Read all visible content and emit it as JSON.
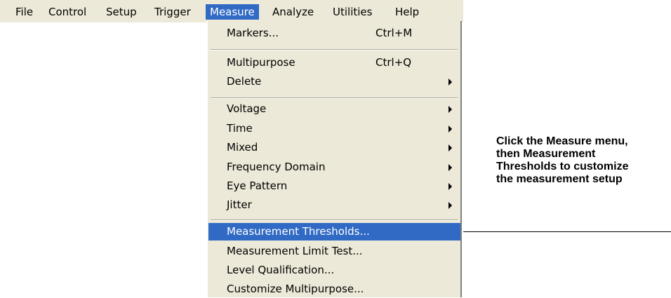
{
  "menubar": {
    "items": [
      {
        "label": "File"
      },
      {
        "label": "Control"
      },
      {
        "label": "Setup"
      },
      {
        "label": "Trigger"
      },
      {
        "label": "Measure",
        "active": true
      },
      {
        "label": "Analyze"
      },
      {
        "label": "Utilities"
      },
      {
        "label": "Help"
      }
    ]
  },
  "measure_menu": {
    "items": [
      {
        "label": "Markers...",
        "shortcut": "Ctrl+M"
      },
      {
        "label": "Multipurpose",
        "shortcut": "Ctrl+Q"
      },
      {
        "label": "Delete",
        "submenu": true
      },
      {
        "label": "Voltage",
        "submenu": true
      },
      {
        "label": "Time",
        "submenu": true
      },
      {
        "label": "Mixed",
        "submenu": true
      },
      {
        "label": "Frequency Domain",
        "submenu": true
      },
      {
        "label": "Eye Pattern",
        "submenu": true
      },
      {
        "label": "Jitter",
        "submenu": true
      },
      {
        "label": "Measurement Thresholds...",
        "highlighted": true
      },
      {
        "label": "Measurement Limit Test..."
      },
      {
        "label": "Level Qualification..."
      },
      {
        "label": "Customize Multipurpose..."
      }
    ]
  },
  "callout": {
    "text": "Click the Measure menu,\nthen Measurement\nThresholds to customize\nthe measurement setup"
  },
  "colors": {
    "menu_background": "#ece9d8",
    "highlight": "#316ac5",
    "highlight_text": "#ffffff"
  }
}
